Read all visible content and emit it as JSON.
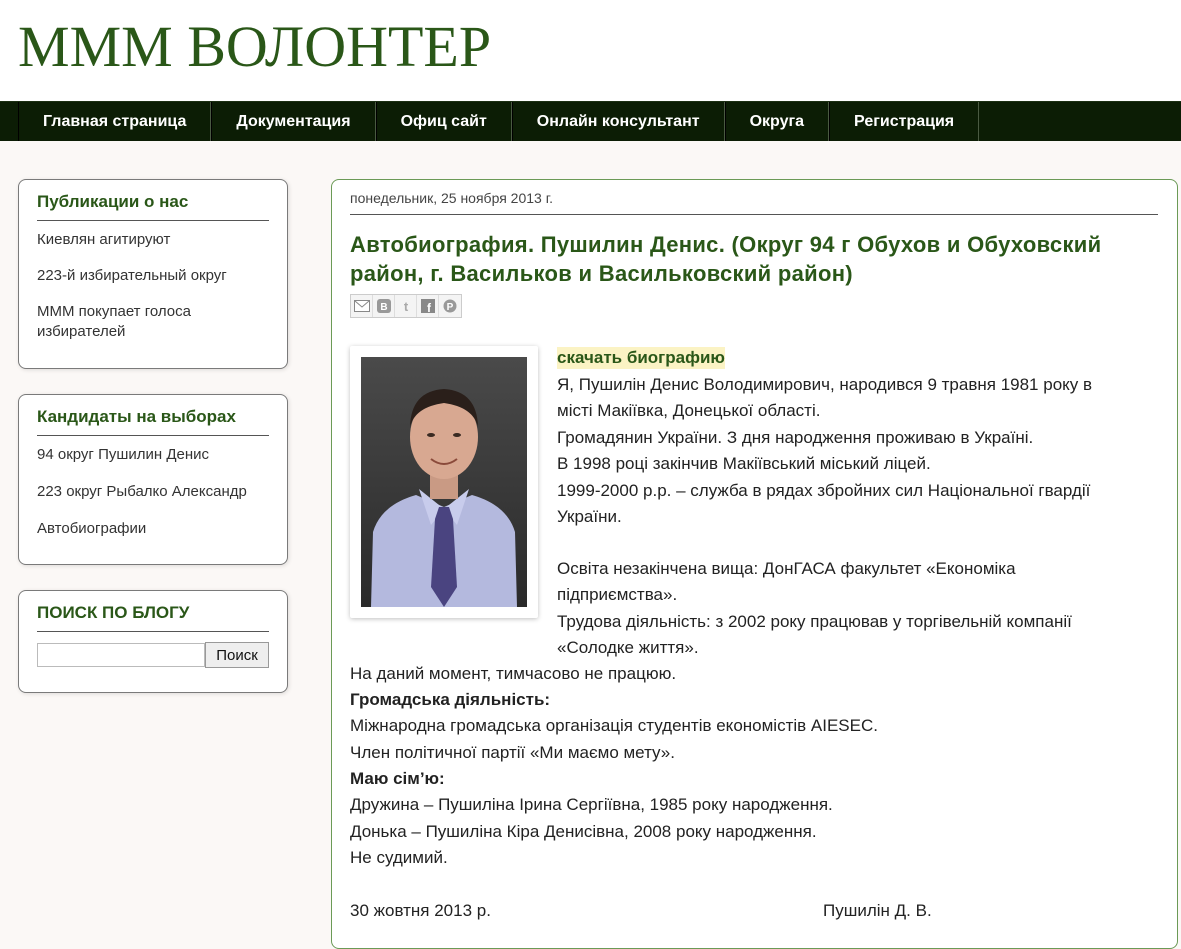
{
  "header": {
    "title": "МММ ВОЛОНТЕР"
  },
  "nav": [
    "Главная страница",
    "Документация",
    "Офиц сайт",
    "Онлайн консультант",
    "Округа",
    "Регистрация"
  ],
  "sidebar": {
    "publications": {
      "title": "Публикации о нас",
      "links": [
        "Киевлян агитируют",
        "223-й избирательный округ",
        "МММ покупает голоса избирателей"
      ]
    },
    "candidates": {
      "title": "Кандидаты на выборах",
      "links": [
        "94 округ Пушилин Денис",
        "223 округ Рыбалко Александр",
        "Автобиографии"
      ]
    },
    "search": {
      "title": "ПОИСК ПО БЛОГУ",
      "input_value": "",
      "button_label": "Поиск"
    }
  },
  "post": {
    "date": "понедельник, 25 ноября 2013 г.",
    "title": "Автобиография. Пушилин Денис. (Округ 94 г Обухов и Обуховский район, г. Васильков и Васильковский район)",
    "share_icons": [
      "email-icon",
      "blogger-icon",
      "twitter-icon",
      "facebook-icon",
      "pinterest-icon"
    ],
    "download_link": "скачать биографию",
    "lines_beside_photo": [
      "Я, Пушилін Денис Володимирович, народився 9 травня 1981 року в",
      "місті Макіївка, Донецької області.",
      "Громадянин України. З дня народження проживаю в Україні.",
      "В 1998 році закінчив Макіївський міський ліцей.",
      "1999-2000 р.р. – служба в рядах збройних сил Національної гвардії",
      "України.",
      "",
      "Освіта незакінчена вища: ДонГАСА факультет «Економіка",
      "підприємства».",
      "Трудова діяльність: з 2002 року працював у торгівельній компанії",
      "«Солодке життя»."
    ],
    "line_unemployed": "На даний момент, тимчасово не працюю.",
    "public_activity_heading": "Громадська діяльність:",
    "public_activity": [
      "Міжнародна громадська організація студентів економістів AIESEC.",
      "Член політичної партії «Ми маємо мету»."
    ],
    "family_heading": "Маю сім’ю:",
    "family": [
      "Дружина – Пушиліна Ірина Сергіївна, 1985 року народження.",
      "Донька – Пушиліна Кіра Денисівна, 2008 року народження.",
      "Не судимий."
    ],
    "signature_date": "30 жовтня 2013 р.",
    "signature_name": "Пушилін Д. В."
  },
  "colors": {
    "accent": "#2a5718",
    "nav_bg": "#0c1d05",
    "link_highlight": "#fbf3c4"
  }
}
